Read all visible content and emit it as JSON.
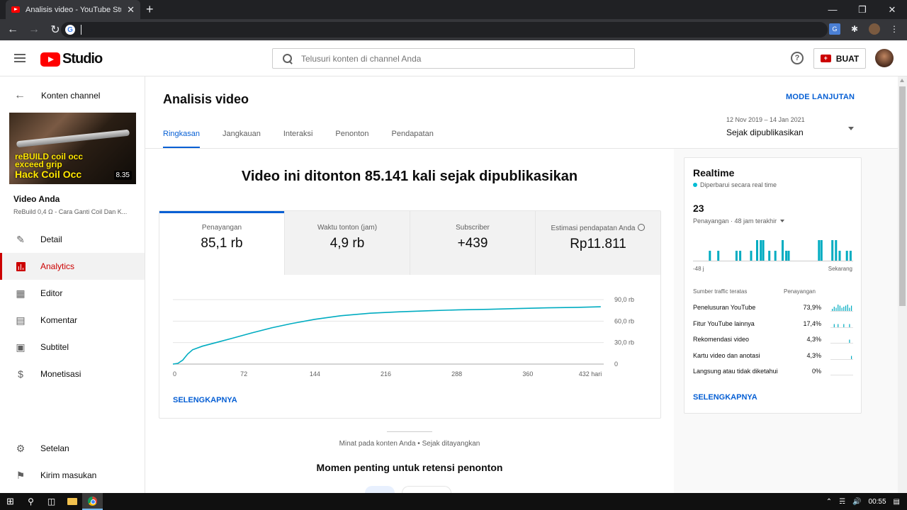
{
  "browser": {
    "tab_title": "Analisis video - YouTube Studio",
    "new_tab": "+",
    "close": "✕"
  },
  "header": {
    "logo_text": "Studio",
    "search_placeholder": "Telusuri konten di channel Anda",
    "help": "?",
    "create_label": "BUAT"
  },
  "sidebar": {
    "back_label": "Konten channel",
    "thumb_line1": "reBUILD coil occ",
    "thumb_line2": "exceed grip",
    "thumb_line3": "Hack Coil Occ",
    "duration": "8.35",
    "video_heading": "Video Anda",
    "video_subtitle": "ReBuild 0,4 Ω - Cara Ganti Coil Dan K...",
    "items": [
      {
        "label": "Detail",
        "icon": "pencil-icon"
      },
      {
        "label": "Analytics",
        "icon": "analytics-icon",
        "active": true
      },
      {
        "label": "Editor",
        "icon": "clapperboard-icon"
      },
      {
        "label": "Komentar",
        "icon": "comment-icon"
      },
      {
        "label": "Subtitel",
        "icon": "subtitles-icon"
      },
      {
        "label": "Monetisasi",
        "icon": "dollar-icon"
      }
    ],
    "bottom_items": [
      {
        "label": "Setelan",
        "icon": "gear-icon"
      },
      {
        "label": "Kirim masukan",
        "icon": "feedback-icon"
      }
    ]
  },
  "main": {
    "title": "Analisis video",
    "advanced": "MODE LANJUTAN",
    "tabs": [
      "Ringkasan",
      "Jangkauan",
      "Interaksi",
      "Penonton",
      "Pendapatan"
    ],
    "date_range": "12 Nov 2019 – 14 Jan 2021",
    "date_label": "Sejak dipublikasikan",
    "headline": "Video ini ditonton 85.141 kali sejak dipublikasikan",
    "metrics": [
      {
        "label": "Penayangan",
        "value": "85,1 rb"
      },
      {
        "label": "Waktu tonton (jam)",
        "value": "4,9 rb"
      },
      {
        "label": "Subscriber",
        "value": "+439"
      },
      {
        "label": "Estimasi pendapatan Anda",
        "value": "Rp11.811"
      }
    ],
    "see_more": "SELENGKAPNYA",
    "interest_caption": "Minat pada konten Anda • Sejak ditayangkan",
    "retention_title": "Momen penting untuk retensi penonton"
  },
  "chart_data": {
    "type": "line",
    "series": [
      {
        "x": [
          0,
          5,
          10,
          15,
          20,
          30,
          45,
          60,
          80,
          100,
          120,
          144,
          170,
          200,
          230,
          260,
          290,
          320,
          350,
          380,
          410,
          434
        ],
        "y": [
          0,
          1000,
          5500,
          14000,
          20000,
          25000,
          30500,
          36000,
          43500,
          50500,
          56500,
          62500,
          67500,
          71000,
          73000,
          74500,
          75800,
          76500,
          77500,
          78500,
          79200,
          80000
        ]
      }
    ],
    "xticks": [
      "0",
      "72",
      "144",
      "216",
      "288",
      "360",
      "432 hari"
    ],
    "yticks": [
      "90,0 rb",
      "60,0 rb",
      "30,0 rb",
      "0"
    ],
    "xlim": [
      0,
      437
    ],
    "ylim": [
      0,
      90000
    ],
    "grid": true,
    "color": "#00acc1"
  },
  "realtime": {
    "title": "Realtime",
    "updated": "Diperbarui secara real time",
    "count": "23",
    "subtitle": "Penayangan · 48 jam terakhir",
    "bars": [
      0,
      0,
      0,
      0,
      0,
      0,
      0,
      0,
      0,
      0,
      0,
      0,
      0,
      1,
      0,
      0,
      0,
      0,
      0,
      0,
      1,
      0,
      0,
      0,
      0,
      0,
      0,
      0,
      0,
      0,
      0,
      0,
      0,
      0,
      0,
      1,
      0,
      0,
      1,
      0,
      0,
      0,
      0,
      0,
      0,
      0,
      0,
      1,
      0,
      0,
      0,
      0,
      2,
      0,
      0,
      2,
      0,
      2,
      0,
      0,
      0,
      0,
      1,
      0,
      0,
      0,
      0,
      1,
      0,
      0,
      0,
      0,
      0,
      2,
      0,
      0,
      1,
      0,
      1,
      0,
      0,
      0,
      0,
      0,
      0,
      0,
      0,
      0,
      0,
      0,
      0,
      0,
      0,
      0,
      0,
      0,
      0,
      0,
      0,
      0,
      0,
      0,
      0,
      2,
      0,
      2,
      0,
      0,
      0,
      0,
      0,
      0,
      0,
      0,
      2,
      0,
      0,
      2,
      0,
      0,
      1,
      0,
      0,
      0,
      0,
      0,
      1,
      0,
      0,
      1,
      0,
      0
    ],
    "axis_left": "-48 j",
    "axis_right": "Sekarang",
    "traffic_header": "Sumber traffic teratas",
    "traffic_col": "Penayangan",
    "sources": [
      {
        "name": "Penelusuran YouTube",
        "pct": "73,9%",
        "spark": [
          2,
          4,
          3,
          6,
          5,
          3,
          4,
          5,
          6,
          3,
          5
        ]
      },
      {
        "name": "Fitur YouTube lainnya",
        "pct": "17,4%",
        "spark": [
          0,
          3,
          0,
          3,
          0,
          0,
          3,
          0,
          0,
          3,
          0
        ]
      },
      {
        "name": "Rekomendasi video",
        "pct": "4,3%",
        "spark": [
          0,
          0,
          0,
          0,
          0,
          0,
          0,
          0,
          0,
          3,
          0
        ]
      },
      {
        "name": "Kartu video dan anotasi",
        "pct": "4,3%",
        "spark": [
          0,
          0,
          0,
          0,
          0,
          0,
          0,
          0,
          0,
          0,
          3
        ]
      },
      {
        "name": "Langsung atau tidak diketahui",
        "pct": "0%",
        "spark": [
          0,
          0,
          0,
          0,
          0,
          0,
          0,
          0,
          0,
          0,
          0
        ]
      }
    ],
    "see_more": "SELENGKAPNYA"
  },
  "taskbar": {
    "time": "00:55"
  }
}
